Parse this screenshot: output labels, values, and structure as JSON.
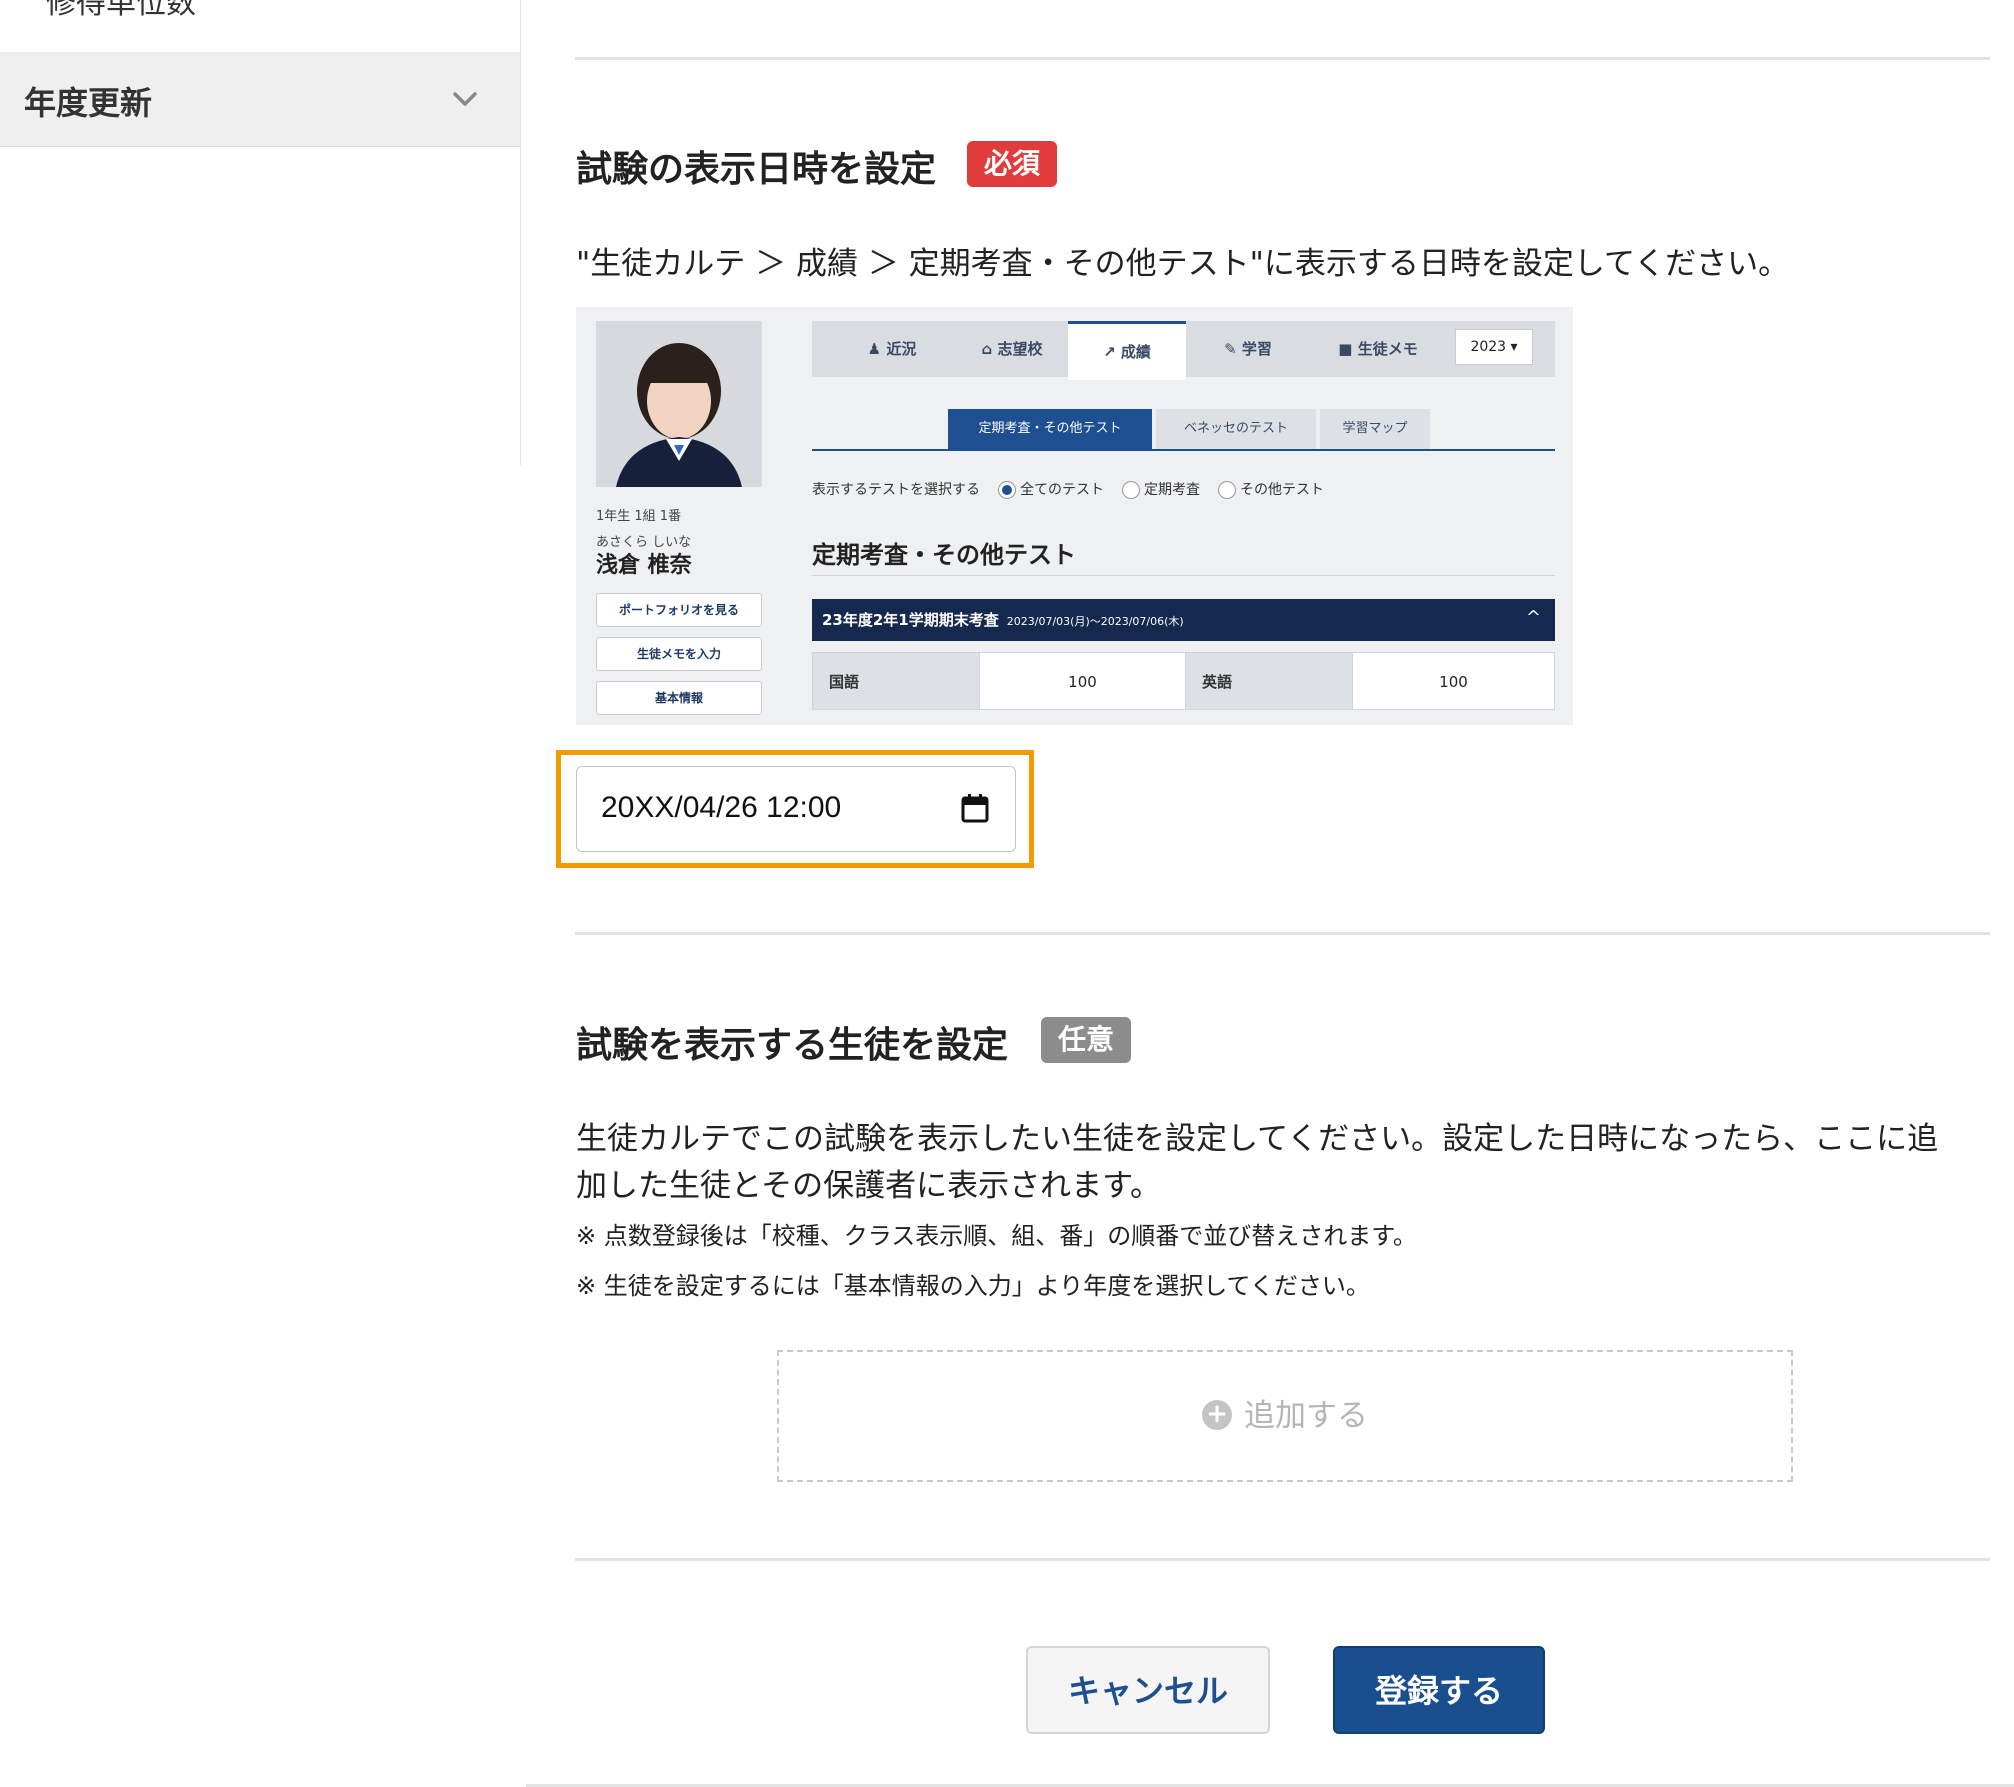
{
  "sidebar": {
    "items": [
      {
        "label": "修得単位数"
      },
      {
        "label": "年度更新"
      }
    ]
  },
  "section_display_date": {
    "title": "試験の表示日時を設定",
    "badge": "必須",
    "description": "\"生徒カルテ ＞ 成績 ＞ 定期考査・その他テスト\"に表示する日時を設定してください。",
    "date_value": "20XX/04/26 12:00",
    "accent_color": "#f29b00"
  },
  "preview": {
    "student": {
      "grade_class": "1年生 1組 1番",
      "kana": "あさくら しいな",
      "name": "浅倉 椎奈",
      "buttons": [
        "ポートフォリオを見る",
        "生徒メモを入力",
        "基本情報"
      ]
    },
    "tabs": [
      "近況",
      "志望校",
      "成績",
      "学習",
      "生徒メモ"
    ],
    "tab_icons": [
      "person-icon",
      "building-icon",
      "chart-icon",
      "pencil-icon",
      "memo-icon"
    ],
    "active_tab": "成績",
    "year": "2023 ▾",
    "subtabs": [
      "定期考査・その他テスト",
      "ベネッセのテスト",
      "学習マップ"
    ],
    "radio_label": "表示するテストを選択する",
    "radio_options": [
      "全てのテスト",
      "定期考査",
      "その他テスト"
    ],
    "heading": "定期考査・その他テスト",
    "exam_title": "23年度2年1学期期末考査",
    "exam_dates": "2023/07/03(月)〜2023/07/06(木)",
    "collapse_mark": "^",
    "scores": [
      {
        "subject": "国語",
        "score": "100"
      },
      {
        "subject": "英語",
        "score": "100"
      }
    ]
  },
  "section_students": {
    "title": "試験を表示する生徒を設定",
    "badge": "任意",
    "description_line1": "生徒カルテでこの試験を表示したい生徒を設定してください。設定した日時になったら、ここに追",
    "description_line2": "加した生徒とその保護者に表示されます。",
    "note1": "※ 点数登録後は「校種、クラス表示順、組、番」の順番で並び替えされます。",
    "note2": "※ 生徒を設定するには「基本情報の入力」より年度を選択してください。",
    "add_label": "追加する",
    "add_icon": "plus-circle-icon"
  },
  "actions": {
    "cancel_label": "キャンセル",
    "submit_label": "登録する",
    "primary_color": "#1a4f8f"
  }
}
